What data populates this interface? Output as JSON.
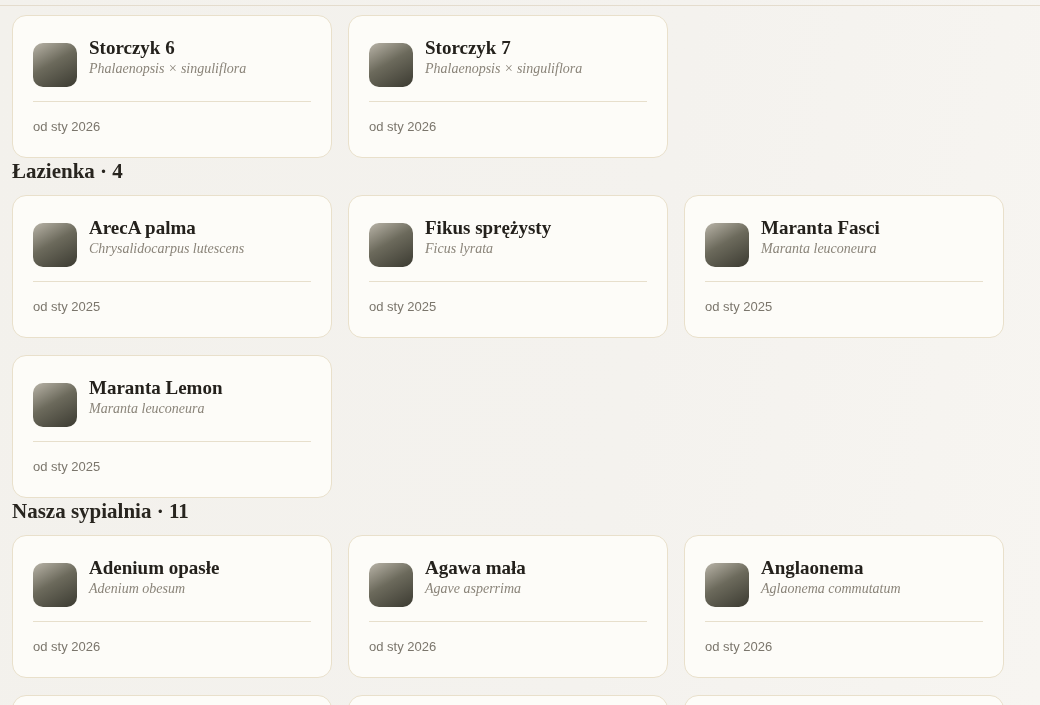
{
  "sections": [
    {
      "plants": [
        {
          "kind": "full",
          "name": "Storczyk 6",
          "species": "Phalaenopsis × singuliflora",
          "since": "od sty 2026"
        },
        {
          "kind": "full",
          "name": "Storczyk 7",
          "species": "Phalaenopsis × singuliflora",
          "since": "od sty 2026"
        }
      ]
    },
    {
      "title": "Łazienka · 4",
      "plants": [
        {
          "kind": "full",
          "name": "ArecA palma",
          "species": "Chrysalidocarpus lutescens",
          "since": "od sty 2025"
        },
        {
          "kind": "full",
          "name": "Fikus sprężysty",
          "species": "Ficus lyrata",
          "since": "od sty 2025"
        },
        {
          "kind": "full",
          "name": "Maranta Fasci",
          "species": "Maranta leuconeura",
          "since": "od sty 2025"
        },
        {
          "kind": "full",
          "name": "Maranta Lemon",
          "species": "Maranta leuconeura",
          "since": "od sty 2025"
        }
      ]
    },
    {
      "title": "Nasza sypialnia · 11",
      "plants": [
        {
          "kind": "full",
          "name": "Adenium opasłe",
          "species": "Adenium obesum",
          "since": "od sty 2026"
        },
        {
          "kind": "full",
          "name": "Agawa mała",
          "species": "Agave asperrima",
          "since": "od sty 2026"
        },
        {
          "kind": "full",
          "name": "Anglaonema",
          "species": "Aglaonema commutatum",
          "since": "od sty 2026"
        },
        {
          "kind": "cut-off"
        },
        {
          "kind": "cut-off"
        },
        {
          "kind": "cut-off"
        }
      ]
    }
  ]
}
